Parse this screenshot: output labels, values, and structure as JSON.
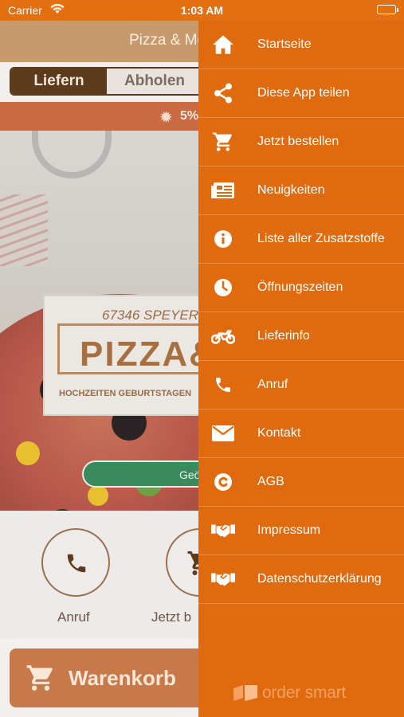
{
  "status_bar": {
    "carrier": "Carrier",
    "time": "1:03 AM"
  },
  "header": {
    "title": "Pizza & Mo"
  },
  "order_mode": {
    "options": [
      "Liefern",
      "Abholen"
    ],
    "selected": "Liefern"
  },
  "promo": {
    "text": "5%"
  },
  "hero": {
    "address": "67346 SPEYER",
    "logo_word": "PIZZA&",
    "tagline": "HOCHZEITEN GEBURTSTAGEN"
  },
  "open_status": "Geö",
  "actions": [
    {
      "label": "Anruf",
      "icon": "phone-icon"
    },
    {
      "label": "Jetzt b",
      "icon": "cart-icon"
    }
  ],
  "cart_button": {
    "label": "Warenkorb"
  },
  "drawer": {
    "items": [
      {
        "label": "Startseite",
        "icon": "home-icon"
      },
      {
        "label": "Diese App teilen",
        "icon": "share-icon"
      },
      {
        "label": "Jetzt bestellen",
        "icon": "cart-icon"
      },
      {
        "label": "Neuigkeiten",
        "icon": "news-icon"
      },
      {
        "label": "Liste aller Zusatzstoffe",
        "icon": "info-icon"
      },
      {
        "label": "Öffnungszeiten",
        "icon": "clock-icon"
      },
      {
        "label": "Lieferinfo",
        "icon": "motorcycle-icon"
      },
      {
        "label": "Anruf",
        "icon": "phone-icon"
      },
      {
        "label": "Kontakt",
        "icon": "envelope-icon"
      },
      {
        "label": "AGB",
        "icon": "copyright-icon"
      },
      {
        "label": "Impressum",
        "icon": "handshake-icon"
      },
      {
        "label": "Datenschutzerklärung",
        "icon": "handshake-icon"
      }
    ],
    "brand": "order smart"
  },
  "colors": {
    "drawer_bg": "#e06a0e",
    "status_bar_bg": "#e37010",
    "dark_brown": "#5c3a1c",
    "promo_red": "#c96a42"
  }
}
